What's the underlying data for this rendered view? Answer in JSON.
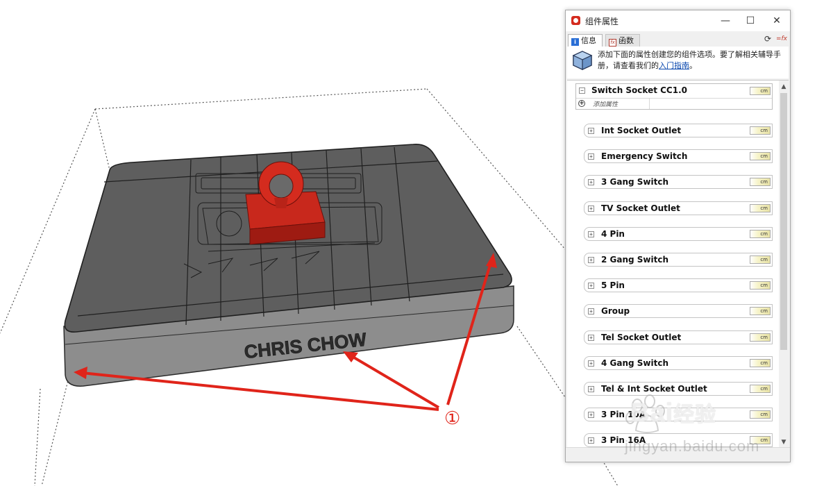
{
  "scene": {
    "embossed_text": "CHRIS CHOW",
    "annotation": "①",
    "annotation_color": "#e0241a",
    "model_colors": {
      "base": "#5e5e5e",
      "component": "#d42b1e"
    }
  },
  "dialog": {
    "title": "组件属性",
    "app_icon": "sketchup-icon",
    "window_buttons": {
      "minimize": "—",
      "maximize": "☐",
      "close": "✕"
    },
    "tabs": [
      {
        "label": "信息",
        "icon": "info-icon",
        "active": true
      },
      {
        "label": "函数",
        "icon": "fx-icon",
        "active": false
      }
    ],
    "toolbar": {
      "refresh": "⟳",
      "toggle_formula": "=fx"
    },
    "info": {
      "icon": "component-cube-icon",
      "text": "添加下面的属性创建您的组件选项。要了解相关辅导手册，请查看我们的",
      "link": "入门指南",
      "suffix": "。"
    },
    "root": {
      "name": "Switch Socket CC1.0",
      "unit": "cm",
      "add_attribute": "添加属性"
    },
    "children": [
      {
        "name": "Int Socket Outlet",
        "unit": "cm"
      },
      {
        "name": "Emergency Switch",
        "unit": "cm"
      },
      {
        "name": "3 Gang Switch",
        "unit": "cm"
      },
      {
        "name": "TV Socket Outlet",
        "unit": "cm"
      },
      {
        "name": "4 Pin",
        "unit": "cm"
      },
      {
        "name": "2 Gang Switch",
        "unit": "cm"
      },
      {
        "name": "5 Pin",
        "unit": "cm"
      },
      {
        "name": "Group",
        "unit": "cm"
      },
      {
        "name": "Tel Socket Outlet",
        "unit": "cm"
      },
      {
        "name": "4 Gang Switch",
        "unit": "cm"
      },
      {
        "name": "Tel & Int Socket Outlet",
        "unit": "cm"
      },
      {
        "name": "3 Pin 10A",
        "unit": "cm"
      },
      {
        "name": "3 Pin 16A",
        "unit": "cm"
      }
    ],
    "scroll": {
      "up": "▲",
      "down": "▼"
    }
  },
  "watermark": {
    "brand": "Bai",
    "brand_cn": "经验",
    "url": "jingyan.baidu.com"
  }
}
